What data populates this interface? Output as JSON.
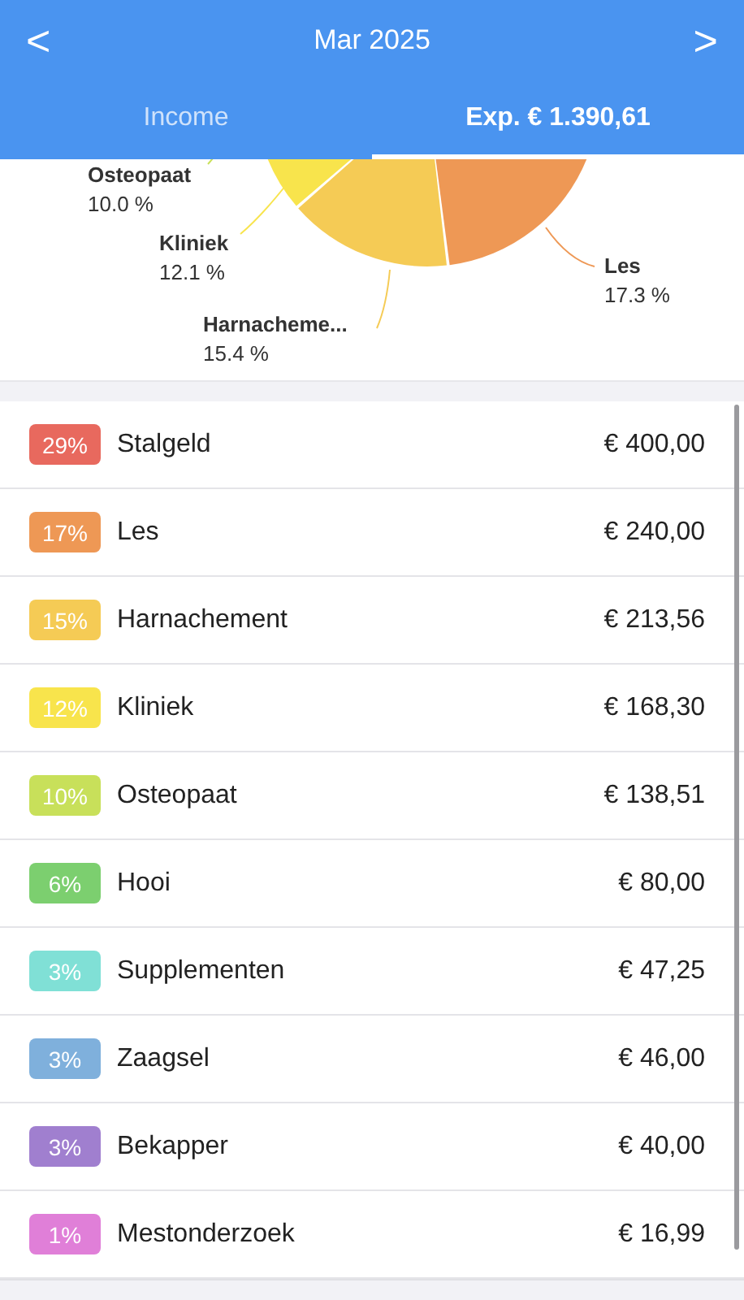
{
  "header": {
    "title": "Mar 2025",
    "prev": "<",
    "next": ">"
  },
  "tabs": [
    {
      "label": "Income",
      "selected": false
    },
    {
      "label": "Exp. € 1.390,61",
      "selected": true
    }
  ],
  "pie_labels": [
    {
      "name": "Osteopaat",
      "percent": "10.0 %",
      "color": "#c8e05a"
    },
    {
      "name": "Kliniek",
      "percent": "12.1 %",
      "color": "#f8e44c"
    },
    {
      "name": "Harnacheme...",
      "percent": "15.4 %",
      "color": "#f5cb55"
    },
    {
      "name": "Les",
      "percent": "17.3 %",
      "color": "#ee9855"
    }
  ],
  "rows": [
    {
      "badge": "29%",
      "name": "Stalgeld",
      "amount": "€ 400,00",
      "color": "#e8695e"
    },
    {
      "badge": "17%",
      "name": "Les",
      "amount": "€ 240,00",
      "color": "#ee9855"
    },
    {
      "badge": "15%",
      "name": "Harnachement",
      "amount": "€ 213,56",
      "color": "#f5cb55"
    },
    {
      "badge": "12%",
      "name": "Kliniek",
      "amount": "€ 168,30",
      "color": "#f8e44c"
    },
    {
      "badge": "10%",
      "name": "Osteopaat",
      "amount": "€ 138,51",
      "color": "#c8e05a"
    },
    {
      "badge": "6%",
      "name": "Hooi",
      "amount": "€ 80,00",
      "color": "#7ccf6f"
    },
    {
      "badge": "3%",
      "name": "Supplementen",
      "amount": "€ 47,25",
      "color": "#80e0d6"
    },
    {
      "badge": "3%",
      "name": "Zaagsel",
      "amount": "€ 46,00",
      "color": "#7fb0dc"
    },
    {
      "badge": "3%",
      "name": "Bekapper",
      "amount": "€ 40,00",
      "color": "#a07fcf"
    },
    {
      "badge": "1%",
      "name": "Mestonderzoek",
      "amount": "€ 16,99",
      "color": "#e07fd8"
    }
  ]
}
